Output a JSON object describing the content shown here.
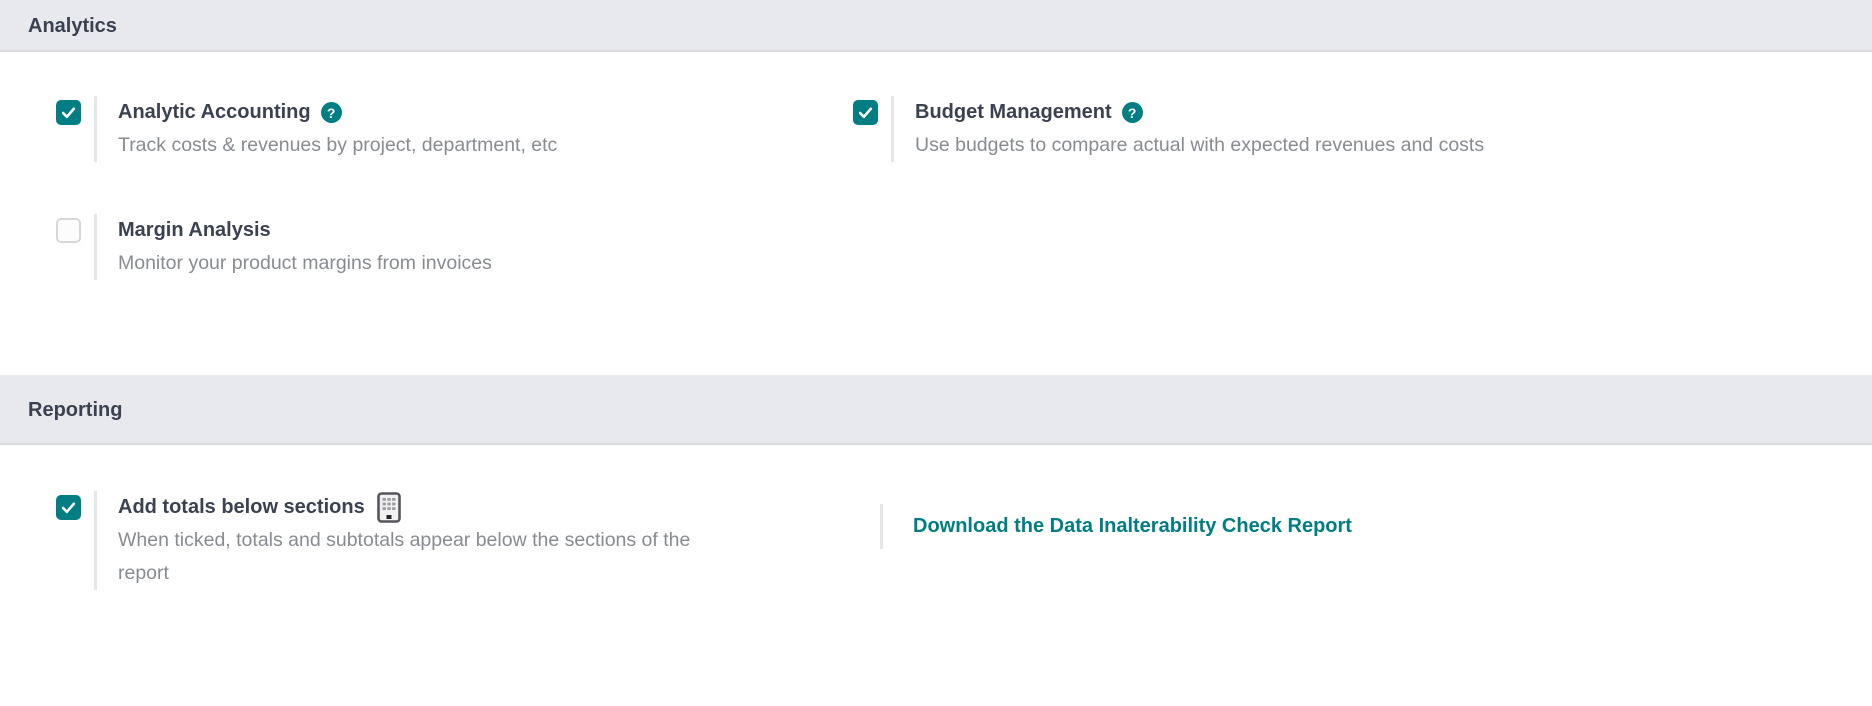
{
  "colors": {
    "accent_teal": "#017e84",
    "section_band_bg": "#e8e9ec",
    "label_text": "#3a4150",
    "description_text": "#878b92",
    "link_text": "#017e84"
  },
  "analytics": {
    "title": "Analytics",
    "analytic_accounting": {
      "label": "Analytic Accounting",
      "help_glyph": "?",
      "description": "Track costs & revenues by project, department, etc",
      "checked": true
    },
    "budget_management": {
      "label": "Budget Management",
      "help_glyph": "?",
      "description": "Use budgets to compare actual with expected revenues and costs",
      "checked": true
    },
    "margin_analysis": {
      "label": "Margin Analysis",
      "description": "Monitor your product margins from invoices",
      "checked": false
    }
  },
  "reporting": {
    "title": "Reporting",
    "add_totals": {
      "label": "Add totals below sections",
      "icon": "calculator-icon",
      "description": "When ticked, totals and subtotals appear below the sections of the report",
      "checked": true
    },
    "download_link": {
      "label": "Download the Data Inalterability Check Report"
    }
  }
}
